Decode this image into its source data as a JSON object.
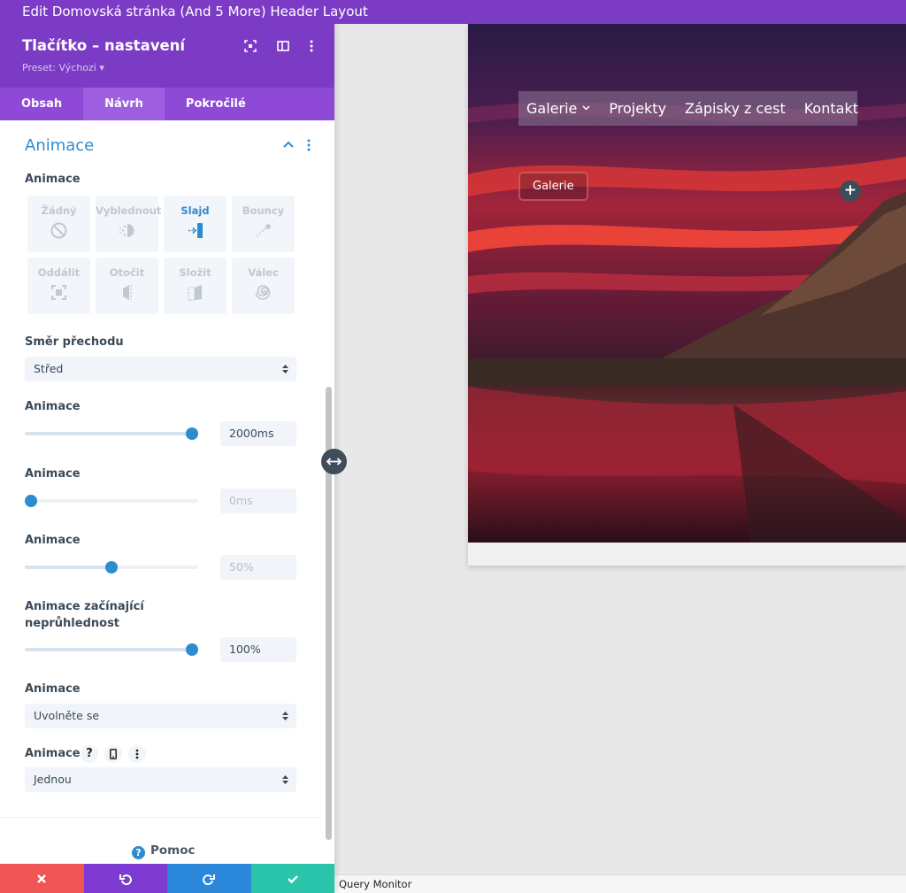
{
  "window": {
    "title": "Edit Domovská stránka (And 5 More) Header Layout"
  },
  "panel": {
    "title": "Tlačítko – nastavení",
    "preset": "Preset: Výchozí ▾",
    "tabs": [
      {
        "label": "Obsah",
        "active": false
      },
      {
        "label": "Návrh",
        "active": true
      },
      {
        "label": "Pokročilé",
        "active": false
      }
    ],
    "section_title": "Animace",
    "animation_label": "Animace",
    "animation_styles": [
      {
        "label": "Žádný",
        "icon": "none-icon",
        "active": false
      },
      {
        "label": "Vyblednout",
        "icon": "fade-icon",
        "active": false
      },
      {
        "label": "Slajd",
        "icon": "slide-icon",
        "active": true
      },
      {
        "label": "Bouncy",
        "icon": "bounce-icon",
        "active": false
      },
      {
        "label": "Oddálit",
        "icon": "zoom-icon",
        "active": false
      },
      {
        "label": "Otočit",
        "icon": "flip-icon",
        "active": false
      },
      {
        "label": "Složit",
        "icon": "fold-icon",
        "active": false
      },
      {
        "label": "Válec",
        "icon": "roll-icon",
        "active": false
      }
    ],
    "direction": {
      "label": "Směr přechodu",
      "value": "Střed"
    },
    "duration": {
      "label": "Animace",
      "value": "2000ms",
      "fraction": 1.0
    },
    "delay": {
      "label": "Animace",
      "value": "0ms",
      "fraction": 0.0
    },
    "intensity": {
      "label": "Animace",
      "value": "50%",
      "fraction": 0.5
    },
    "opacity": {
      "label_line1": "Animace začínající",
      "label_line2": "neprůhlednost",
      "value": "100%",
      "fraction": 1.0
    },
    "easing": {
      "label": "Animace",
      "value": "Uvolněte se"
    },
    "repeat": {
      "label": "Animace",
      "help_glyph": "?",
      "value": "Jednou"
    },
    "help": {
      "label": "Pomoc",
      "glyph": "?"
    }
  },
  "preview": {
    "menu": [
      "Galerie",
      "Projekty",
      "Zápisky z cest",
      "Kontakt"
    ],
    "button_label": "Galerie",
    "plus_glyph": "+"
  },
  "statusbar": {
    "label": "Query Monitor"
  },
  "colors": {
    "purple_header": "#7b3bc4",
    "accent_blue": "#2d8ccf",
    "cancel_red": "#ef5555",
    "undo_purple": "#7d3bd1",
    "redo_blue": "#2b87da",
    "save_green": "#29c4a9"
  }
}
